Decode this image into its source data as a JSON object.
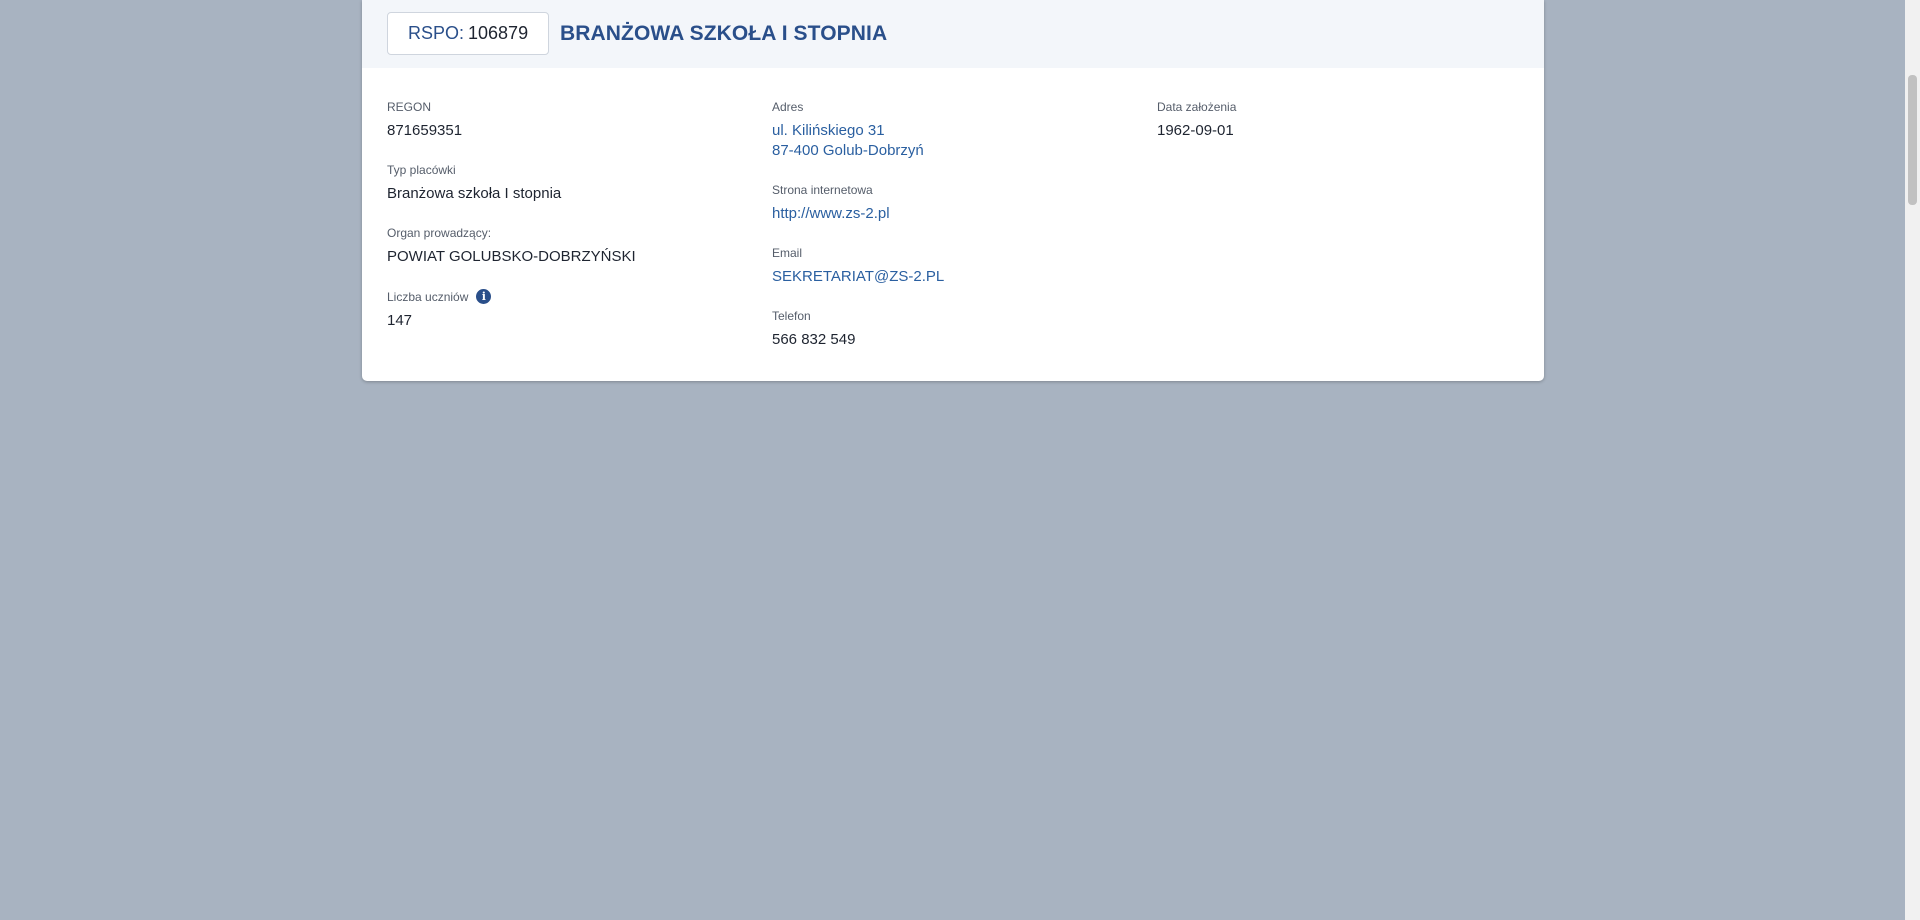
{
  "header": {
    "rspo_label": "RSPO:",
    "rspo_value": "106879",
    "title": "BRANŻOWA SZKOŁA I STOPNIA"
  },
  "details": {
    "regon": {
      "label": "REGON",
      "value": "871659351"
    },
    "typ": {
      "label": "Typ placówki",
      "value": "Branżowa szkoła I stopnia"
    },
    "organ": {
      "label": "Organ prowadzący:",
      "value": "POWIAT GOLUBSKO-DOBRZYŃSKI"
    },
    "uczniowie": {
      "label": "Liczba uczniów",
      "value": "147",
      "icon": "info-icon"
    },
    "adres": {
      "label": "Adres",
      "line1": "ul. Kilińskiego 31",
      "line2": "87-400 Golub-Dobrzyń"
    },
    "strona": {
      "label": "Strona internetowa",
      "value": "http://www.zs-2.pl"
    },
    "email": {
      "label": "Email",
      "value": "SEKRETARIAT@ZS-2.PL"
    },
    "telefon": {
      "label": "Telefon",
      "value": "566 832 549"
    },
    "data_zalozenia": {
      "label": "Data założenia",
      "value": "1962-09-01"
    }
  },
  "colors": {
    "background": "#a8b3c1",
    "accent": "#2a4f8a",
    "link": "#2a5fa0"
  }
}
